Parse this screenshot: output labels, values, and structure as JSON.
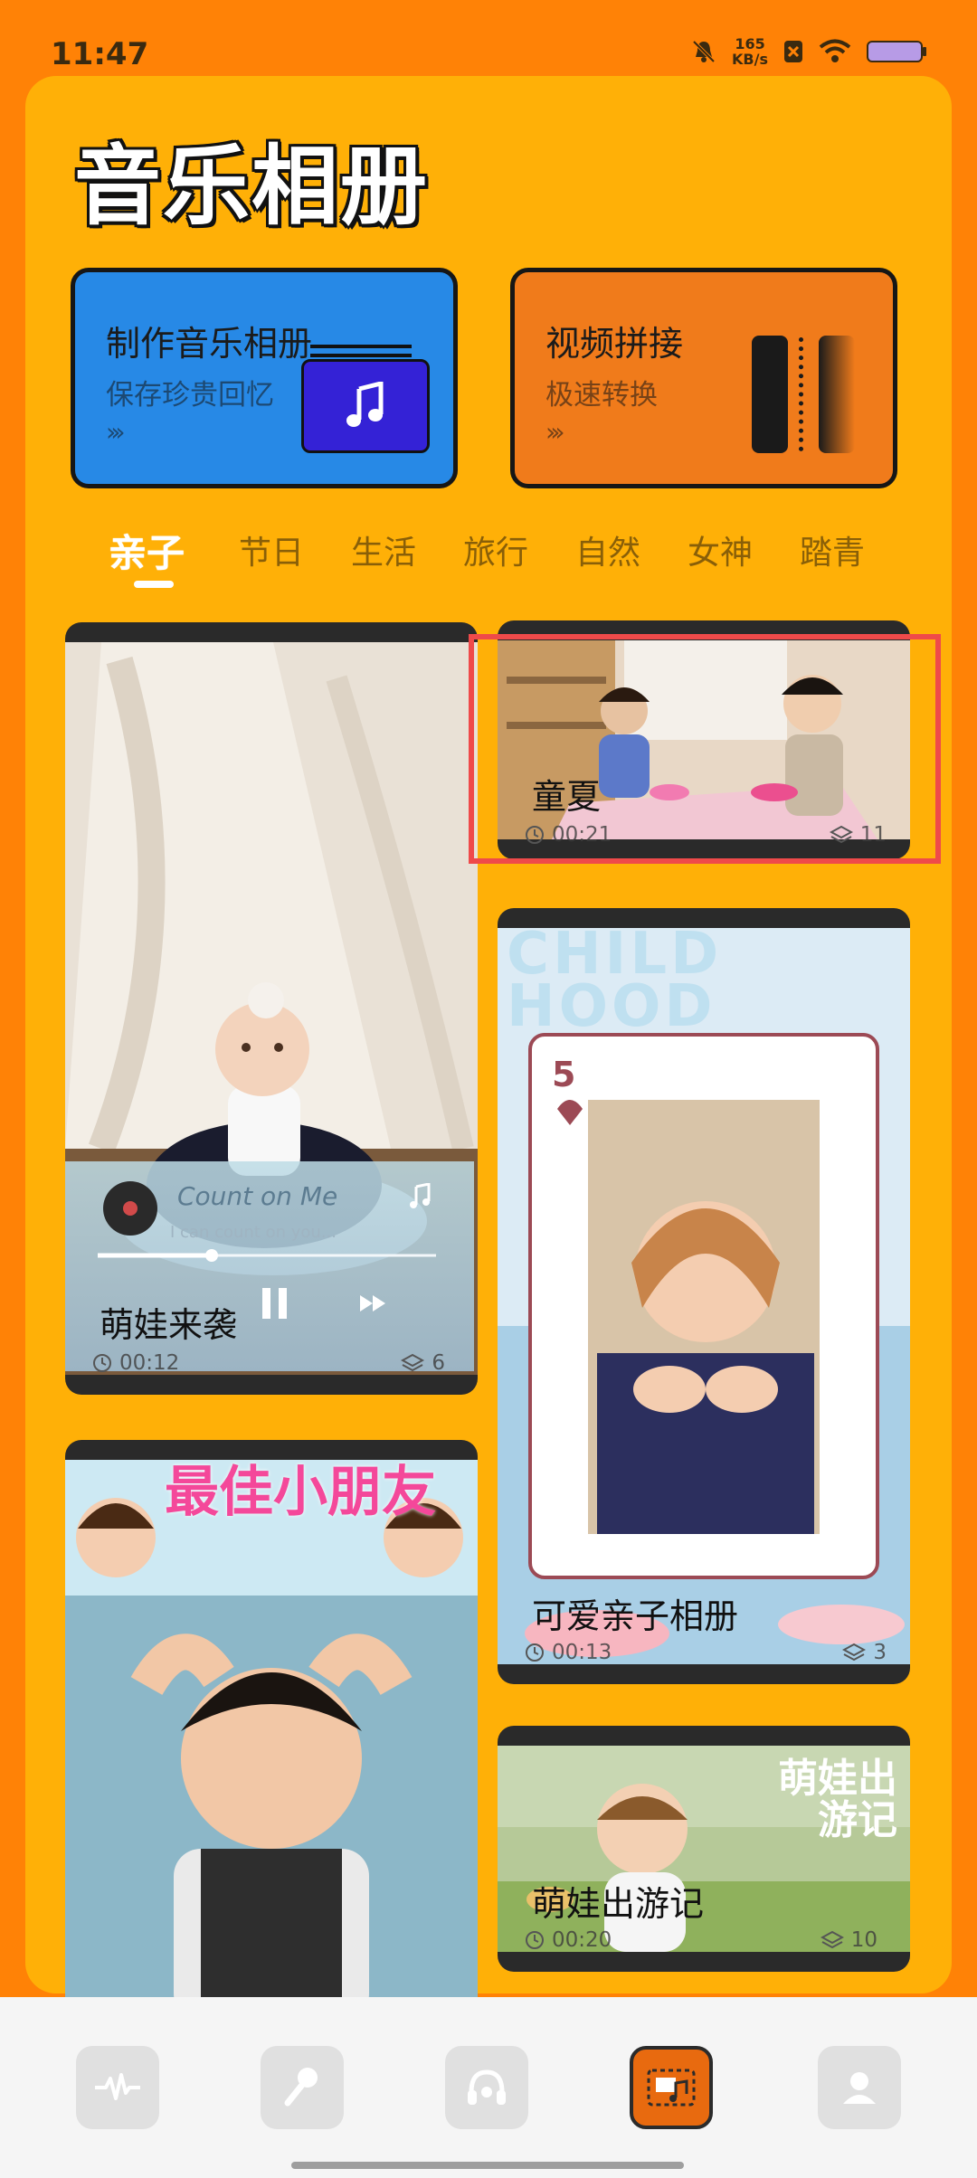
{
  "status_bar": {
    "time": "11:47",
    "speed_value": "165",
    "speed_unit": "KB/s"
  },
  "header": {
    "title": "音乐相册"
  },
  "features": [
    {
      "title": "制作音乐相册",
      "subtitle": "保存珍贵回忆",
      "arrows": "›››",
      "icon": "music-note-icon"
    },
    {
      "title": "视频拼接",
      "subtitle": "极速转换",
      "arrows": "›››",
      "icon": "video-splice-icon"
    }
  ],
  "tabs": [
    "亲子",
    "节日",
    "生活",
    "旅行",
    "自然",
    "女神",
    "踏青"
  ],
  "active_tab": "亲子",
  "templates": [
    {
      "title": "萌娃来袭",
      "duration": "00:12",
      "count": "6"
    },
    {
      "title": "童夏",
      "duration": "00:21",
      "count": "11"
    },
    {
      "title": "可爱亲子相册",
      "duration": "00:13",
      "count": "3"
    },
    {
      "title": "萌娃出游记",
      "duration": "00:20",
      "count": "10"
    }
  ],
  "preview_text": {
    "song_title": "Count on Me",
    "song_sub": "I can count on you...",
    "childhood_banner": "CHILD HOOD",
    "card_rank": "5",
    "best_kid": "最佳小朋友",
    "trip_title": "萌娃出游记"
  },
  "bottom_nav": [
    "waveform-icon",
    "microphone-icon",
    "headphones-icon",
    "music-album-icon",
    "profile-icon"
  ],
  "colors": {
    "background": "#FF8206",
    "panel": "#FFB007",
    "blue_card": "#2789E6",
    "orange_card": "#F07B1B"
  }
}
